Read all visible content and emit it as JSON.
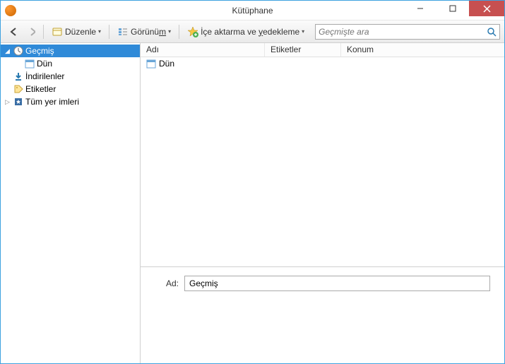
{
  "window": {
    "title": "Kütüphane"
  },
  "toolbar": {
    "organize_label": "Düzenle",
    "views_label": "Görünüm",
    "import_label_pre": "İçe aktarma ve ",
    "import_label_u": "y",
    "import_label_post": "edekleme"
  },
  "search": {
    "placeholder": "Geçmişte ara"
  },
  "sidebar": {
    "items": [
      {
        "label": "Geçmiş",
        "icon": "clock",
        "expanded": true,
        "selected": true,
        "level": 0
      },
      {
        "label": "Dün",
        "icon": "calendar",
        "level": 1
      },
      {
        "label": "İndirilenler",
        "icon": "download",
        "level": 0
      },
      {
        "label": "Etiketler",
        "icon": "tag",
        "level": 0
      },
      {
        "label": "Tüm yer imleri",
        "icon": "bookmark",
        "expanded": false,
        "level": 0
      }
    ]
  },
  "columns": {
    "name": "Adı",
    "tags": "Etiketler",
    "location": "Konum"
  },
  "rows": [
    {
      "name": "Dün",
      "icon": "calendar"
    }
  ],
  "details": {
    "name_label": "Ad:",
    "name_value": "Geçmiş"
  }
}
